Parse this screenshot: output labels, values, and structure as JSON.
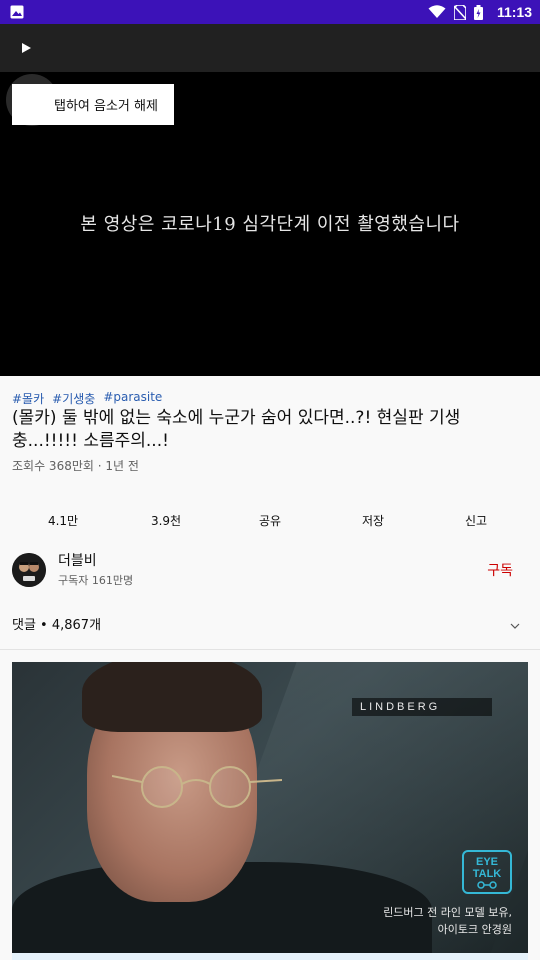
{
  "status_bar": {
    "time": "11:13"
  },
  "video": {
    "mute_toast": "탭하여 음소거 해제",
    "caption": "본 영상은 코로나19 심각단계 이전 촬영했습니다"
  },
  "info": {
    "tags": [
      "#몰카",
      "#기생충",
      "#parasite"
    ],
    "title": "(몰카) 둘 밖에 없는 숙소에 누군가 숨어 있다면..?! 현실판 기생충...!!!!! 소름주의...!",
    "meta": "조회수 368만회 · 1년 전"
  },
  "actions": {
    "like": "4.1만",
    "dislike": "3.9천",
    "share": "공유",
    "save": "저장",
    "report": "신고"
  },
  "channel": {
    "name": "더블비",
    "subscribers": "구독자 161만명",
    "subscribe_label": "구독"
  },
  "comments": {
    "label": "댓글 • 4,867개"
  },
  "ad": {
    "brand": "LINDBERG",
    "badge_line1": "EYE",
    "badge_line2": "TALK",
    "copy_line1": "린드버그 전 라인 모델 보유,",
    "copy_line2": "아이토크 안경원"
  }
}
